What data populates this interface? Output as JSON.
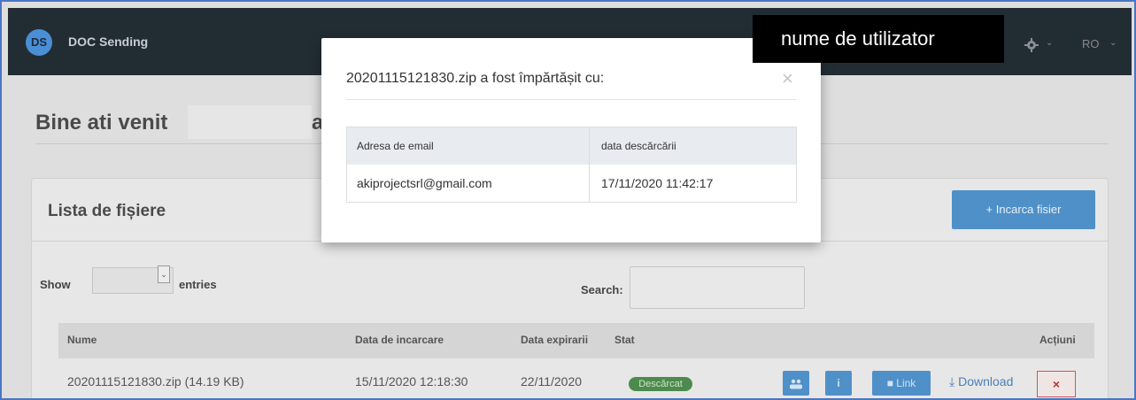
{
  "app": {
    "logo_text": "DS",
    "title": "DOC Sending"
  },
  "header": {
    "username": "nume de utilizator",
    "language": "RO",
    "caret": "⌄"
  },
  "welcome": {
    "prefix": "Bine ati venit",
    "suffix": "a"
  },
  "files_card": {
    "title": "Lista de fișiere",
    "upload_label": "+ Incarca fisier",
    "show_label": "Show",
    "entries_label": "entries",
    "search_label": "Search:",
    "columns": [
      "Nume",
      "Data de incarcare",
      "Data expirarii",
      "Stat",
      "Acțiuni"
    ],
    "rows": [
      {
        "name": "20201115121830.zip (14.19 KB)",
        "uploaded": "15/11/2020 12:18:30",
        "expires": "22/11/2020",
        "status": "Descărcat",
        "actions": {
          "info": "i",
          "link": "Link",
          "download": "Download",
          "delete": "×"
        }
      }
    ]
  },
  "modal": {
    "title": "20201115121830.zip a fost împărtășit cu:",
    "close": "×",
    "columns": [
      "Adresa de email",
      "data descărcării"
    ],
    "rows": [
      {
        "email": "akiprojectsrl@gmail.com",
        "date": "17/11/2020 11:42:17"
      }
    ]
  },
  "colors": {
    "topbar": "#222d33",
    "accent": "#4f90c9",
    "status_green": "#4d8a4d",
    "danger": "#cc5555"
  }
}
